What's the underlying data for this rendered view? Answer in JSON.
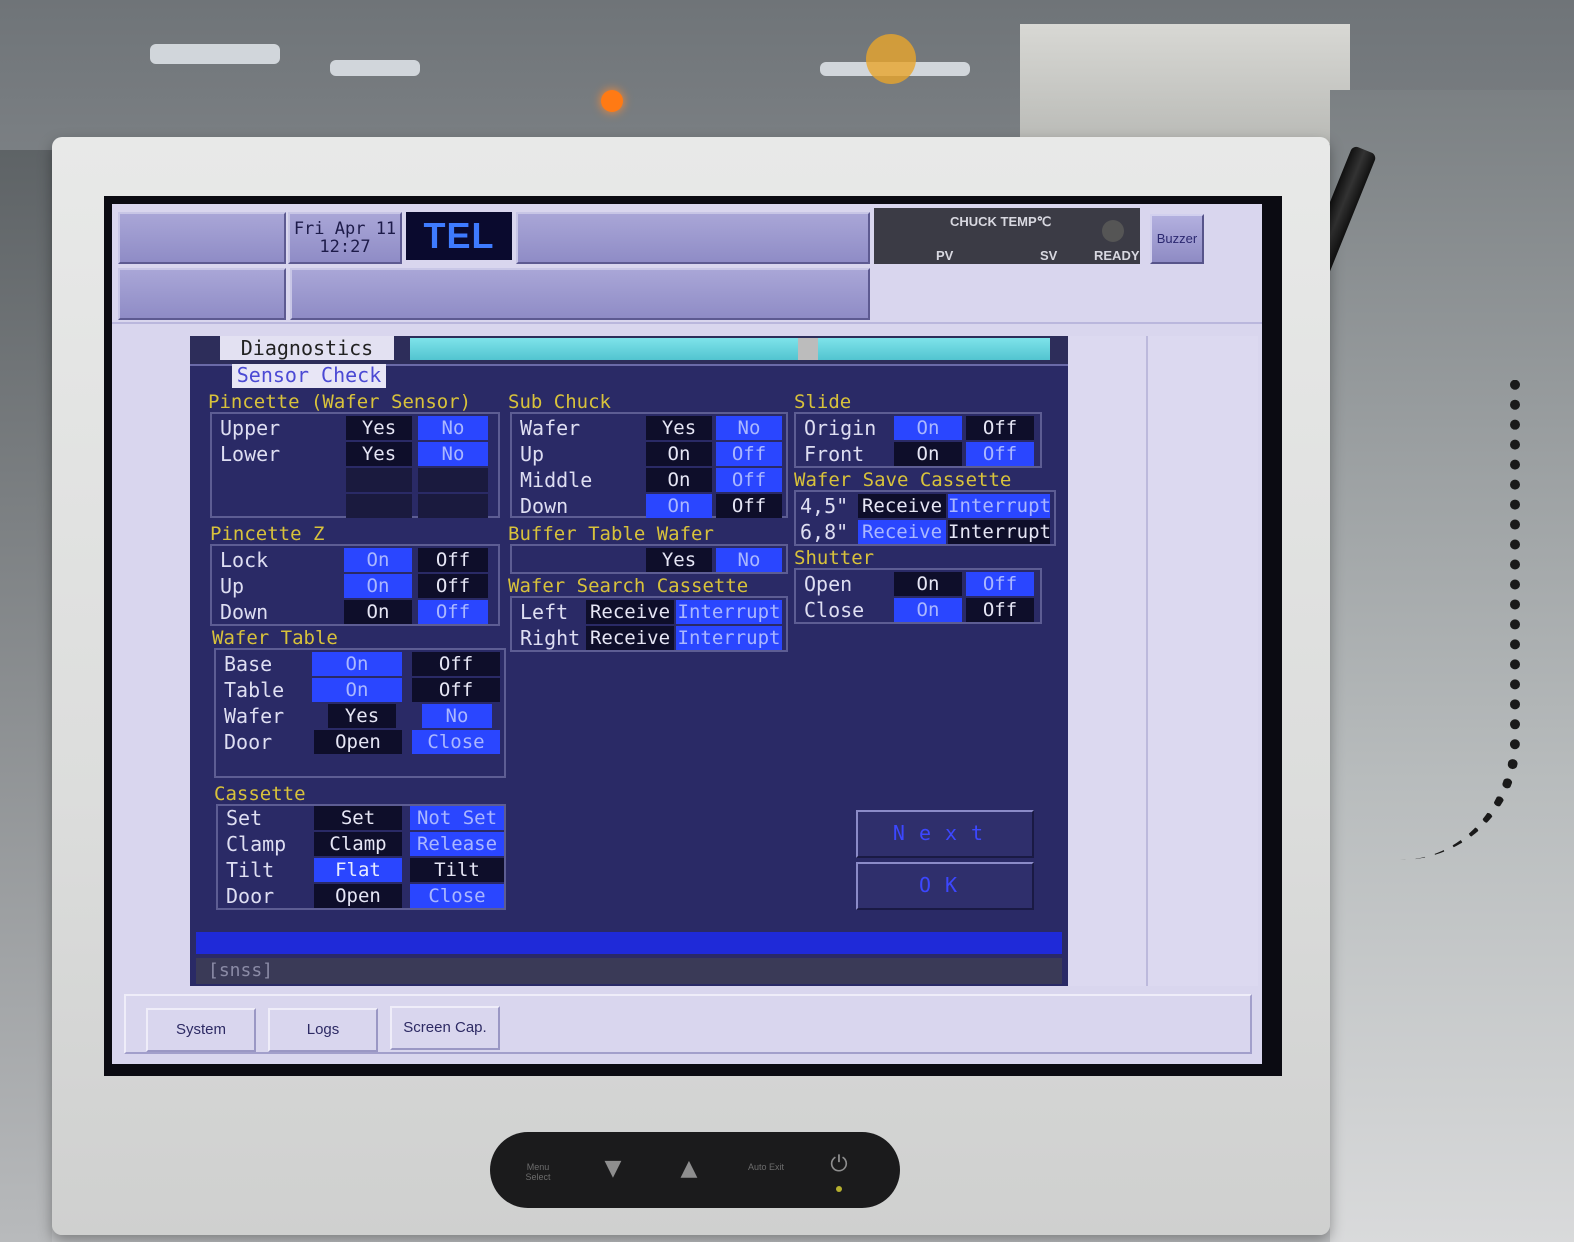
{
  "header": {
    "date": "Fri Apr 11",
    "time": "12:27",
    "logo": "TEL",
    "chuck_temp_label": "CHUCK TEMP℃",
    "pv_label": "PV",
    "sv_label": "SV",
    "ready_label": "READY",
    "buzzer_label": "Buzzer"
  },
  "tabs": {
    "diagnostics": "Diagnostics",
    "sensor_check": "Sensor Check"
  },
  "sections": {
    "pincette_wafer_sensor": {
      "title": "Pincette (Wafer Sensor)",
      "rows": [
        {
          "label": "Upper",
          "a": "Yes",
          "b": "No"
        },
        {
          "label": "Lower",
          "a": "Yes",
          "b": "No"
        }
      ]
    },
    "pincette_z": {
      "title": "Pincette Z",
      "rows": [
        {
          "label": "Lock",
          "a": "On",
          "b": "Off"
        },
        {
          "label": "Up",
          "a": "On",
          "b": "Off"
        },
        {
          "label": "Down",
          "a": "On",
          "b": "Off"
        }
      ]
    },
    "wafer_table": {
      "title": "Wafer Table",
      "rows": [
        {
          "label": "Base",
          "a": "On",
          "b": "Off"
        },
        {
          "label": "Table",
          "a": "On",
          "b": "Off"
        },
        {
          "label": "Wafer",
          "a": "Yes",
          "b": "No"
        },
        {
          "label": "Door",
          "a": "Open",
          "b": "Close"
        }
      ]
    },
    "cassette": {
      "title": "Cassette",
      "rows": [
        {
          "label": "Set",
          "a": "Set",
          "b": "Not Set"
        },
        {
          "label": "Clamp",
          "a": "Clamp",
          "b": "Release"
        },
        {
          "label": "Tilt",
          "a": "Flat",
          "b": "Tilt"
        },
        {
          "label": "Door",
          "a": "Open",
          "b": "Close"
        }
      ]
    },
    "sub_chuck": {
      "title": "Sub Chuck",
      "rows": [
        {
          "label": "Wafer",
          "a": "Yes",
          "b": "No"
        },
        {
          "label": "Up",
          "a": "On",
          "b": "Off"
        },
        {
          "label": "Middle",
          "a": "On",
          "b": "Off"
        },
        {
          "label": "Down",
          "a": "On",
          "b": "Off"
        }
      ]
    },
    "buffer_table_wafer": {
      "title": "Buffer Table Wafer",
      "a": "Yes",
      "b": "No"
    },
    "wafer_search_cassette": {
      "title": "Wafer Search Cassette",
      "rows": [
        {
          "label": "Left",
          "a": "Receive",
          "b": "Interrupt"
        },
        {
          "label": "Right",
          "a": "Receive",
          "b": "Interrupt"
        }
      ]
    },
    "slide": {
      "title": "Slide",
      "rows": [
        {
          "label": "Origin",
          "a": "On",
          "b": "Off"
        },
        {
          "label": "Front",
          "a": "On",
          "b": "Off"
        }
      ]
    },
    "wafer_save_cassette": {
      "title": "Wafer Save Cassette",
      "rows": [
        {
          "label": "4,5\"",
          "a": "Receive",
          "b": "Interrupt"
        },
        {
          "label": "6,8\"",
          "a": "Receive",
          "b": "Interrupt"
        }
      ]
    },
    "shutter": {
      "title": "Shutter",
      "rows": [
        {
          "label": "Open",
          "a": "On",
          "b": "Off"
        },
        {
          "label": "Close",
          "a": "On",
          "b": "Off"
        }
      ]
    }
  },
  "buttons": {
    "next": "Next",
    "ok": "OK"
  },
  "command_line": "[snss]",
  "bottom_bar": {
    "system": "System",
    "logs": "Logs",
    "screen_cap": "Screen Cap."
  },
  "monitor_controls": {
    "menu_select": "Menu Select",
    "down_glyph": "▼",
    "up_glyph": "▲",
    "auto_exit": "Auto Exit",
    "power_glyph": "⏻"
  }
}
